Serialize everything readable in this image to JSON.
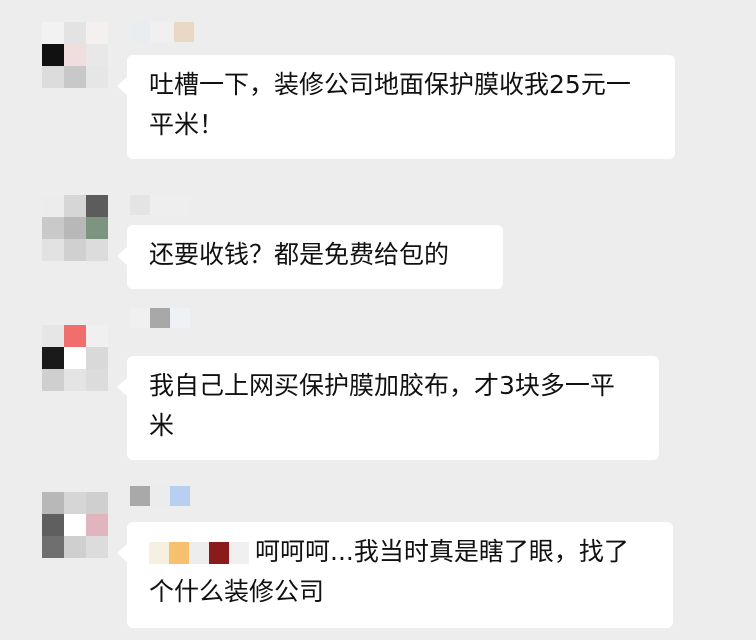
{
  "messages": [
    {
      "text": "吐槽一下，装修公司地面保护膜收我25元一平米！"
    },
    {
      "text": "还要收钱？都是免费给包的"
    },
    {
      "text": "我自己上网买保护膜加胶布，才3块多一平米"
    },
    {
      "text": "呵呵呵...我当时真是瞎了眼，找了个什么装修公司"
    }
  ],
  "colors": {
    "background": "#ededed",
    "bubble": "#ffffff",
    "text": "#111111"
  },
  "icons": [
    "avatar-mosaic",
    "nickname-mosaic"
  ]
}
